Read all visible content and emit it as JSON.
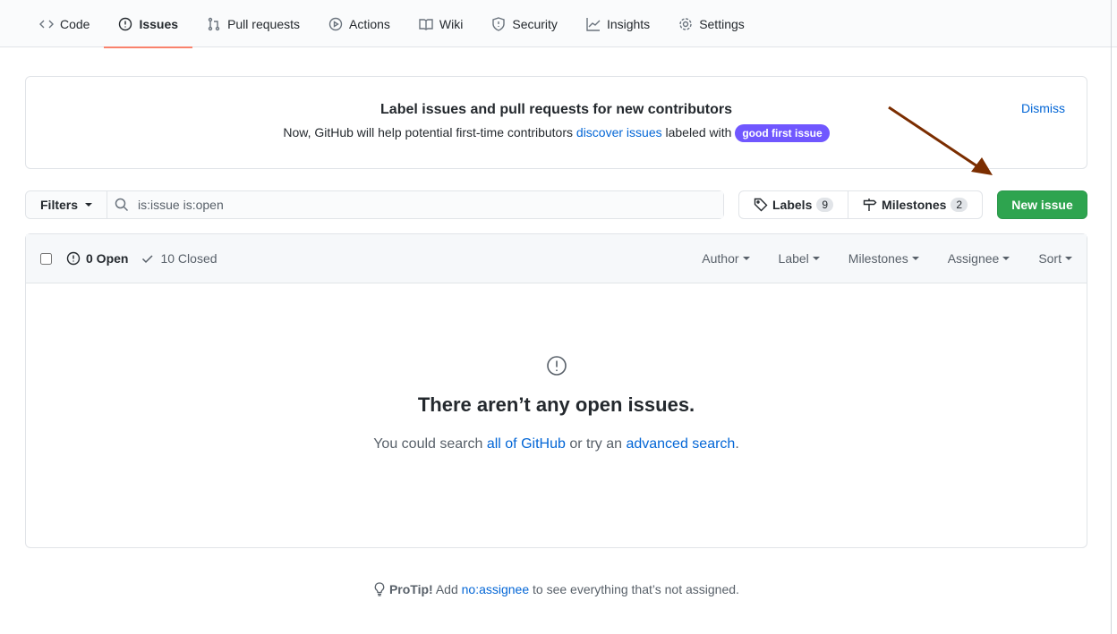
{
  "nav": {
    "tabs": [
      {
        "label": "Code",
        "icon": "code-icon"
      },
      {
        "label": "Issues",
        "icon": "issue-icon",
        "selected": true
      },
      {
        "label": "Pull requests",
        "icon": "pull-request-icon"
      },
      {
        "label": "Actions",
        "icon": "play-icon"
      },
      {
        "label": "Wiki",
        "icon": "book-icon"
      },
      {
        "label": "Security",
        "icon": "shield-icon"
      },
      {
        "label": "Insights",
        "icon": "graph-icon"
      },
      {
        "label": "Settings",
        "icon": "gear-icon"
      }
    ]
  },
  "banner": {
    "title": "Label issues and pull requests for new contributors",
    "text_before": "Now, GitHub will help potential first-time contributors ",
    "link": "discover issues",
    "text_after": " labeled with ",
    "pill": "good first issue",
    "dismiss": "Dismiss"
  },
  "toolbar": {
    "filters": "Filters",
    "search_value": "is:issue is:open",
    "labels": "Labels",
    "labels_count": "9",
    "milestones": "Milestones",
    "milestones_count": "2",
    "new_issue": "New issue"
  },
  "list": {
    "open": "0 Open",
    "closed": "10 Closed",
    "filters": [
      "Author",
      "Label",
      "Milestones",
      "Assignee",
      "Sort"
    ]
  },
  "empty": {
    "title": "There aren’t any open issues.",
    "t1": "You could search ",
    "l1": "all of GitHub",
    "t2": " or try an ",
    "l2": "advanced search",
    "t3": "."
  },
  "protip": {
    "label": "ProTip!",
    "t1": " Add ",
    "link": "no:assignee",
    "t2": " to see everything that’s not assigned."
  },
  "colors": {
    "accent": "#f9826c",
    "green": "#2ea44f",
    "pill": "#7057ff",
    "link": "#0366d6",
    "arrow": "#7b2d00"
  }
}
